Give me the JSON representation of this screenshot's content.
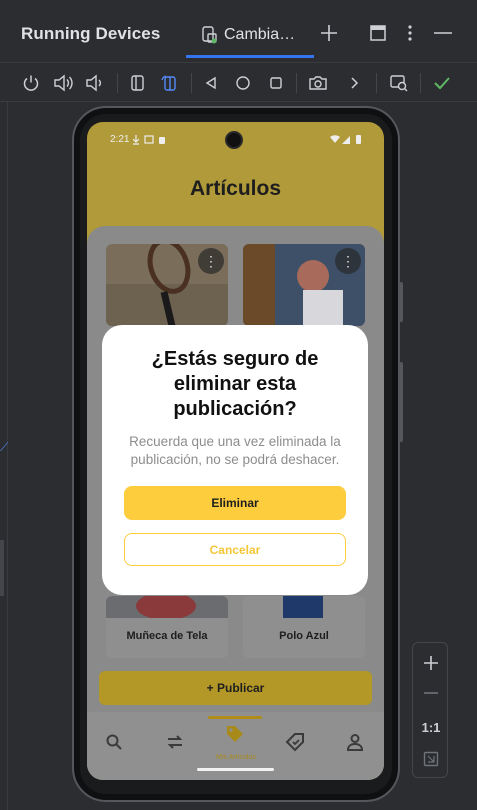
{
  "panel": {
    "title": "Running Devices",
    "tab_label": "Cambia…"
  },
  "colors": {
    "accent": "#3574f0",
    "brand_yellow": "#fdcd3e",
    "dialog_secondary_text": "#f5c737",
    "check_green": "#5fb865"
  },
  "toolbar": {
    "icons": [
      "power-icon",
      "volume-up-icon",
      "volume-down-icon",
      "rotate-left-icon",
      "rotate-right-icon",
      "back-icon",
      "home-icon",
      "overview-icon",
      "camera-icon",
      "more-actions-icon",
      "device-mirror-icon",
      "check-icon"
    ]
  },
  "zoom": {
    "one_to_one": "1:1"
  },
  "device": {
    "status_time": "2:21",
    "app_title": "Artículos",
    "cards": [
      {
        "label": ""
      },
      {
        "label": ""
      },
      {
        "label": "Muñeca de Tela"
      },
      {
        "label": "Polo Azul"
      }
    ],
    "publish_label": "+ Publicar",
    "nav": {
      "items": [
        "search-icon",
        "swap-icon",
        "tag-icon",
        "wishlist-tag-icon",
        "profile-icon"
      ],
      "active_label": "Mis Artículos"
    }
  },
  "dialog": {
    "title": "¿Estás seguro de eliminar esta publicación?",
    "body": "Recuerda que una vez eliminada la publicación, no se podrá deshacer.",
    "primary_label": "Eliminar",
    "secondary_label": "Cancelar"
  }
}
